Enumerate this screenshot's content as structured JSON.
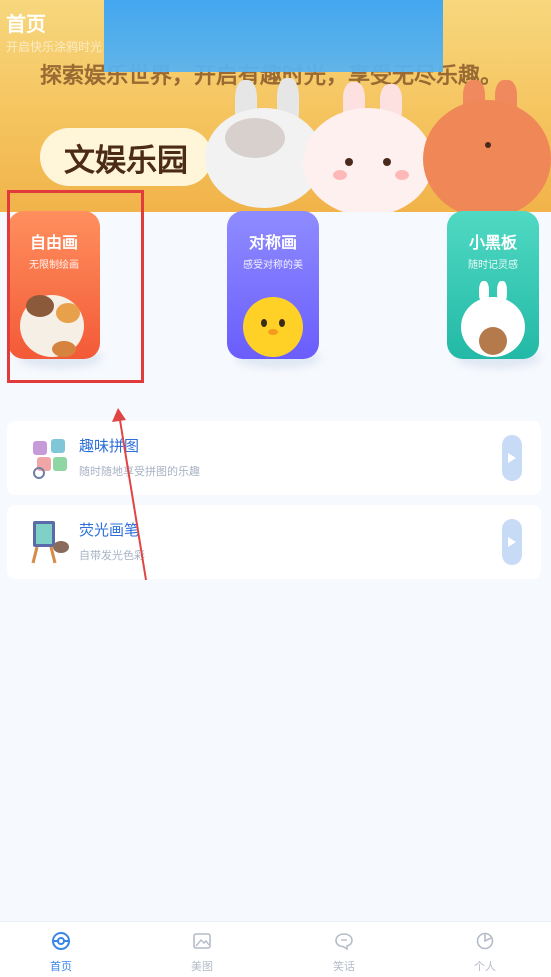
{
  "status": {
    "title": "首页",
    "subtitle": "开启快乐涂鸦时光"
  },
  "banner": {
    "slogan": "探索娱乐世界，开启有趣时光，享受无尽乐趣。",
    "badge": "文娱乐园"
  },
  "features": [
    {
      "title": "自由画",
      "subtitle": "无限制绘画",
      "icon": "calico-cat-mascot-icon"
    },
    {
      "title": "对称画",
      "subtitle": "感受对称的美",
      "icon": "yellow-chick-mascot-icon"
    },
    {
      "title": "小黑板",
      "subtitle": "随时记灵感",
      "icon": "bunny-bear-mascot-icon"
    }
  ],
  "list": [
    {
      "title": "趣味拼图",
      "subtitle": "随时随地享受拼图的乐趣",
      "icon": "puzzle-icon"
    },
    {
      "title": "荧光画笔",
      "subtitle": "自带发光色彩",
      "icon": "easel-icon"
    }
  ],
  "tabs": [
    {
      "label": "首页",
      "icon": "home-ball-icon",
      "active": true
    },
    {
      "label": "美图",
      "icon": "picture-icon",
      "active": false
    },
    {
      "label": "笑话",
      "icon": "chat-icon",
      "active": false
    },
    {
      "label": "个人",
      "icon": "person-icon",
      "active": false
    }
  ],
  "colors": {
    "accent": "#3a86e8",
    "highlight": "#e23b3b",
    "card_red": "#f35a37",
    "card_purple": "#6a5dfc",
    "card_teal": "#22b9a6"
  }
}
